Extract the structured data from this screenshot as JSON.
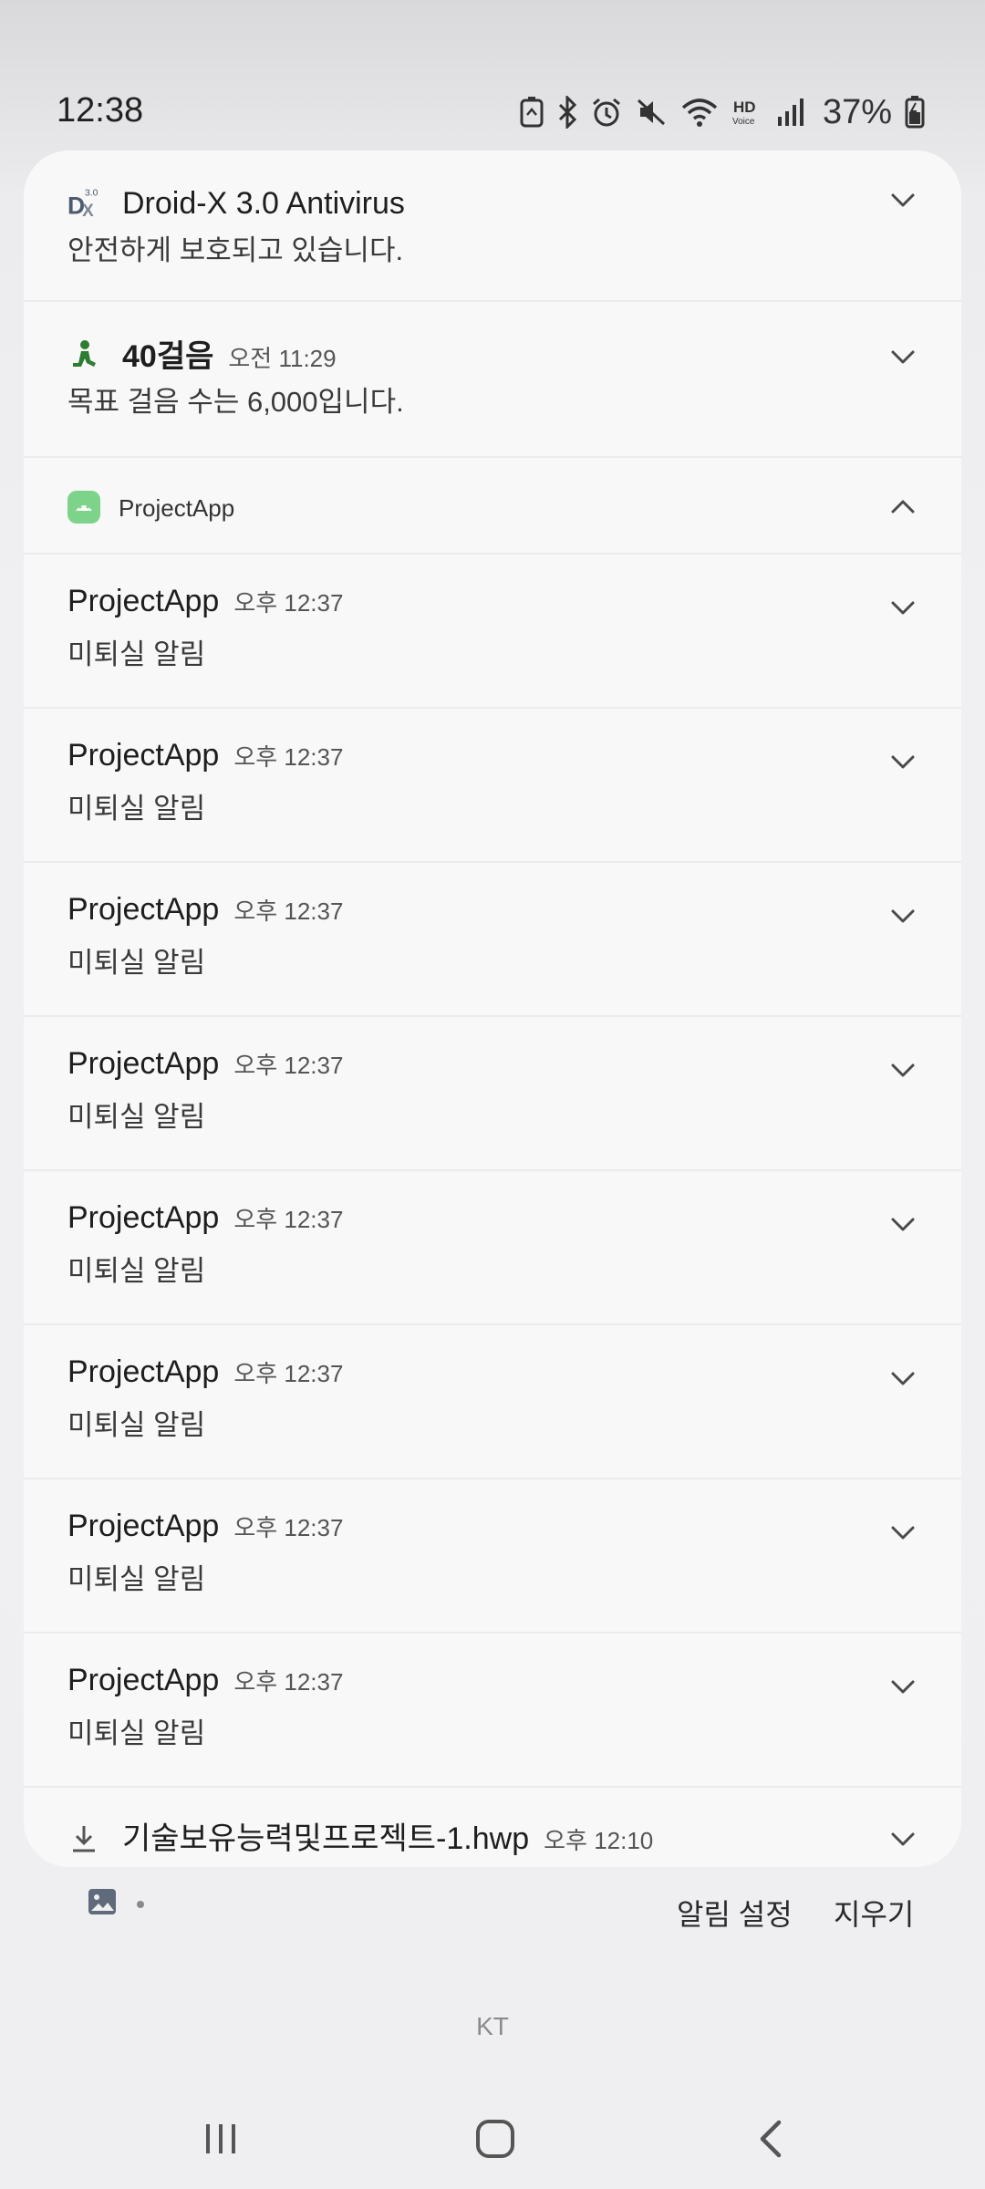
{
  "status_bar": {
    "time": "12:38",
    "battery_percent": "37%",
    "icons": [
      "battery-saver-icon",
      "bluetooth-icon",
      "alarm-icon",
      "mute-icon",
      "wifi-icon",
      "hd-voice-icon",
      "signal-icon",
      "battery-icon"
    ]
  },
  "notifications": {
    "antivirus": {
      "app": "Droid-X 3.0 Antivirus",
      "body": "안전하게 보호되고 있습니다."
    },
    "steps": {
      "app": "40걸음",
      "time": "오전 11:29",
      "body": "목표 걸음 수는 6,000입니다."
    },
    "group": {
      "app": "ProjectApp",
      "items": [
        {
          "title": "ProjectApp",
          "time": "오후 12:37",
          "body": "미퇴실 알림"
        },
        {
          "title": "ProjectApp",
          "time": "오후 12:37",
          "body": "미퇴실 알림"
        },
        {
          "title": "ProjectApp",
          "time": "오후 12:37",
          "body": "미퇴실 알림"
        },
        {
          "title": "ProjectApp",
          "time": "오후 12:37",
          "body": "미퇴실 알림"
        },
        {
          "title": "ProjectApp",
          "time": "오후 12:37",
          "body": "미퇴실 알림"
        },
        {
          "title": "ProjectApp",
          "time": "오후 12:37",
          "body": "미퇴실 알림"
        },
        {
          "title": "ProjectApp",
          "time": "오후 12:37",
          "body": "미퇴실 알림"
        },
        {
          "title": "ProjectApp",
          "time": "오후 12:37",
          "body": "미퇴실 알림"
        }
      ]
    },
    "download": {
      "title": "기술보유능력및프로젝트-1.hwp",
      "time": "오후 12:10"
    }
  },
  "bottom_actions": {
    "settings_label": "알림 설정",
    "clear_label": "지우기"
  },
  "carrier": "KT"
}
